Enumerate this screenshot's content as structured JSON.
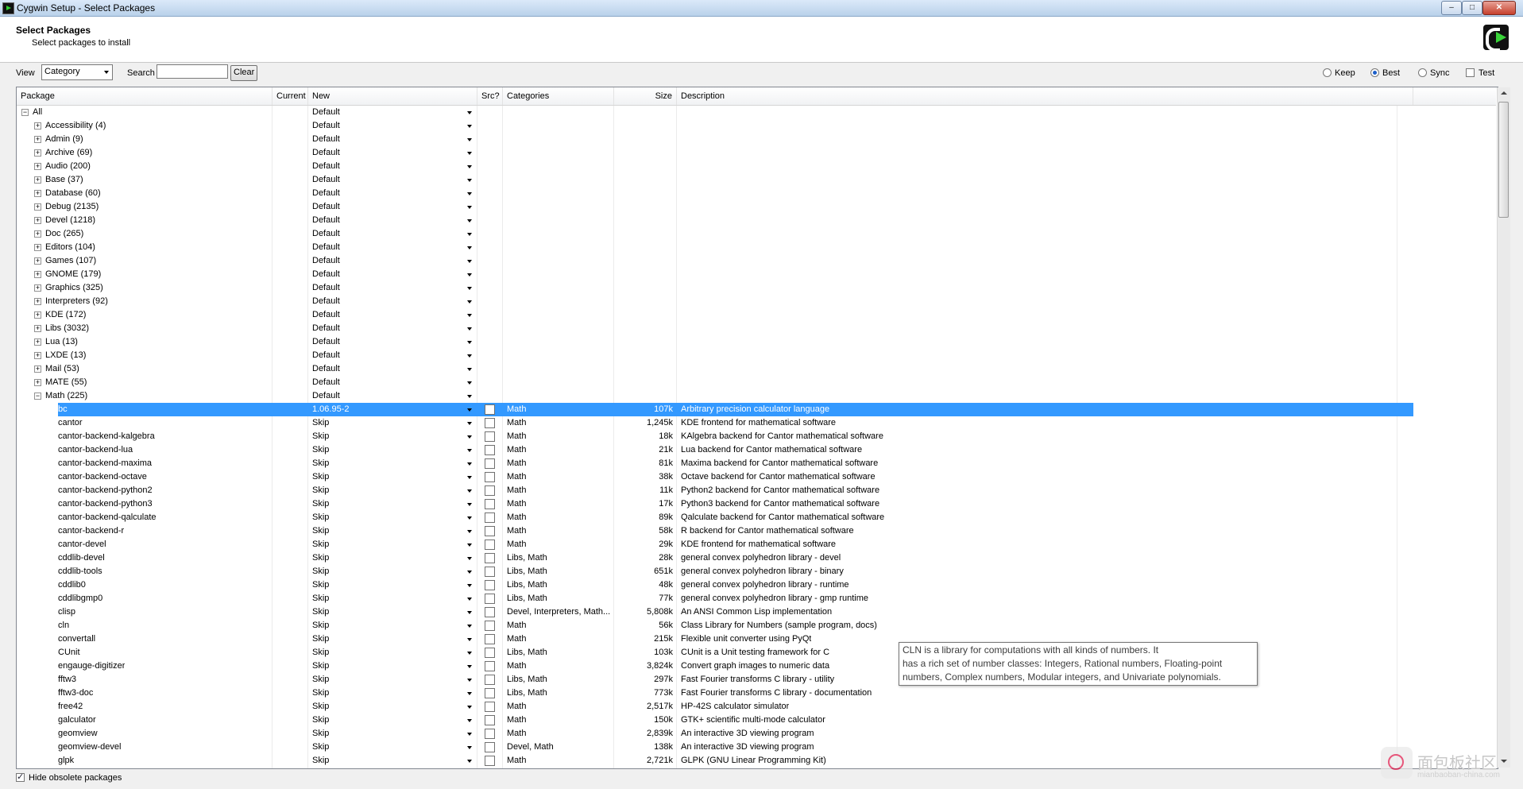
{
  "window": {
    "title": "Cygwin Setup - Select Packages",
    "minimize": "–",
    "maximize": "□",
    "close": "✕"
  },
  "header": {
    "title": "Select Packages",
    "subtitle": "Select packages to install"
  },
  "toolbar": {
    "view_label": "View",
    "view_value": "Category",
    "search_label": "Search",
    "search_value": "",
    "clear_label": "Clear",
    "keep_label": "Keep",
    "best_label": "Best",
    "sync_label": "Sync",
    "test_label": "Test",
    "selected_mode": "Best",
    "test_checked": false
  },
  "columns": [
    "Package",
    "Current",
    "New",
    "Src?",
    "Categories",
    "Size",
    "Description"
  ],
  "categories": [
    {
      "name": "All",
      "new": "Default",
      "expanded": true,
      "level": 0
    },
    {
      "name": "Accessibility (4)",
      "new": "Default",
      "level": 1
    },
    {
      "name": "Admin (9)",
      "new": "Default",
      "level": 1
    },
    {
      "name": "Archive (69)",
      "new": "Default",
      "level": 1
    },
    {
      "name": "Audio (200)",
      "new": "Default",
      "level": 1
    },
    {
      "name": "Base (37)",
      "new": "Default",
      "level": 1
    },
    {
      "name": "Database (60)",
      "new": "Default",
      "level": 1
    },
    {
      "name": "Debug (2135)",
      "new": "Default",
      "level": 1
    },
    {
      "name": "Devel (1218)",
      "new": "Default",
      "level": 1
    },
    {
      "name": "Doc (265)",
      "new": "Default",
      "level": 1
    },
    {
      "name": "Editors (104)",
      "new": "Default",
      "level": 1
    },
    {
      "name": "Games (107)",
      "new": "Default",
      "level": 1
    },
    {
      "name": "GNOME (179)",
      "new": "Default",
      "level": 1
    },
    {
      "name": "Graphics (325)",
      "new": "Default",
      "level": 1
    },
    {
      "name": "Interpreters (92)",
      "new": "Default",
      "level": 1
    },
    {
      "name": "KDE (172)",
      "new": "Default",
      "level": 1
    },
    {
      "name": "Libs (3032)",
      "new": "Default",
      "level": 1
    },
    {
      "name": "Lua (13)",
      "new": "Default",
      "level": 1
    },
    {
      "name": "LXDE (13)",
      "new": "Default",
      "level": 1
    },
    {
      "name": "Mail (53)",
      "new": "Default",
      "level": 1
    },
    {
      "name": "MATE (55)",
      "new": "Default",
      "level": 1
    },
    {
      "name": "Math (225)",
      "new": "Default",
      "expanded": true,
      "level": 1
    }
  ],
  "packages": [
    {
      "name": "bc",
      "current": "",
      "new": "1.06.95-2",
      "categories": "Math",
      "size": "107k",
      "description": "Arbitrary precision calculator language",
      "selected": true
    },
    {
      "name": "cantor",
      "current": "",
      "new": "Skip",
      "categories": "Math",
      "size": "1,245k",
      "description": "KDE frontend for mathematical software"
    },
    {
      "name": "cantor-backend-kalgebra",
      "current": "",
      "new": "Skip",
      "categories": "Math",
      "size": "18k",
      "description": "KAlgebra backend for Cantor mathematical software"
    },
    {
      "name": "cantor-backend-lua",
      "current": "",
      "new": "Skip",
      "categories": "Math",
      "size": "21k",
      "description": "Lua backend for Cantor mathematical software"
    },
    {
      "name": "cantor-backend-maxima",
      "current": "",
      "new": "Skip",
      "categories": "Math",
      "size": "81k",
      "description": "Maxima backend for Cantor mathematical software"
    },
    {
      "name": "cantor-backend-octave",
      "current": "",
      "new": "Skip",
      "categories": "Math",
      "size": "38k",
      "description": "Octave backend for Cantor mathematical software"
    },
    {
      "name": "cantor-backend-python2",
      "current": "",
      "new": "Skip",
      "categories": "Math",
      "size": "11k",
      "description": "Python2 backend for Cantor mathematical software"
    },
    {
      "name": "cantor-backend-python3",
      "current": "",
      "new": "Skip",
      "categories": "Math",
      "size": "17k",
      "description": "Python3 backend for Cantor mathematical software"
    },
    {
      "name": "cantor-backend-qalculate",
      "current": "",
      "new": "Skip",
      "categories": "Math",
      "size": "89k",
      "description": "Qalculate backend for Cantor mathematical software"
    },
    {
      "name": "cantor-backend-r",
      "current": "",
      "new": "Skip",
      "categories": "Math",
      "size": "58k",
      "description": "R backend for Cantor mathematical software"
    },
    {
      "name": "cantor-devel",
      "current": "",
      "new": "Skip",
      "categories": "Math",
      "size": "29k",
      "description": "KDE frontend for mathematical software"
    },
    {
      "name": "cddlib-devel",
      "current": "",
      "new": "Skip",
      "categories": "Libs, Math",
      "size": "28k",
      "description": "general convex polyhedron library - devel"
    },
    {
      "name": "cddlib-tools",
      "current": "",
      "new": "Skip",
      "categories": "Libs, Math",
      "size": "651k",
      "description": "general convex polyhedron library - binary"
    },
    {
      "name": "cddlib0",
      "current": "",
      "new": "Skip",
      "categories": "Libs, Math",
      "size": "48k",
      "description": "general convex polyhedron library - runtime"
    },
    {
      "name": "cddlibgmp0",
      "current": "",
      "new": "Skip",
      "categories": "Libs, Math",
      "size": "77k",
      "description": "general convex polyhedron library - gmp runtime"
    },
    {
      "name": "clisp",
      "current": "",
      "new": "Skip",
      "categories": "Devel, Interpreters, Math...",
      "size": "5,808k",
      "description": "An ANSI Common Lisp implementation"
    },
    {
      "name": "cln",
      "current": "",
      "new": "Skip",
      "categories": "Math",
      "size": "56k",
      "description": "Class Library for Numbers (sample program, docs)"
    },
    {
      "name": "convertall",
      "current": "",
      "new": "Skip",
      "categories": "Math",
      "size": "215k",
      "description": "Flexible unit converter using PyQt"
    },
    {
      "name": "CUnit",
      "current": "",
      "new": "Skip",
      "categories": "Libs, Math",
      "size": "103k",
      "description": "CUnit is a Unit testing framework for C"
    },
    {
      "name": "engauge-digitizer",
      "current": "",
      "new": "Skip",
      "categories": "Math",
      "size": "3,824k",
      "description": "Convert graph images to numeric data"
    },
    {
      "name": "fftw3",
      "current": "",
      "new": "Skip",
      "categories": "Libs, Math",
      "size": "297k",
      "description": "Fast Fourier transforms C library - utility"
    },
    {
      "name": "fftw3-doc",
      "current": "",
      "new": "Skip",
      "categories": "Libs, Math",
      "size": "773k",
      "description": "Fast Fourier transforms C library - documentation"
    },
    {
      "name": "free42",
      "current": "",
      "new": "Skip",
      "categories": "Math",
      "size": "2,517k",
      "description": "HP-42S calculator simulator"
    },
    {
      "name": "galculator",
      "current": "",
      "new": "Skip",
      "categories": "Math",
      "size": "150k",
      "description": "GTK+ scientific multi-mode calculator"
    },
    {
      "name": "geomview",
      "current": "",
      "new": "Skip",
      "categories": "Math",
      "size": "2,839k",
      "description": "An interactive 3D viewing program"
    },
    {
      "name": "geomview-devel",
      "current": "",
      "new": "Skip",
      "categories": "Devel, Math",
      "size": "138k",
      "description": "An interactive 3D viewing program"
    },
    {
      "name": "glpk",
      "current": "",
      "new": "Skip",
      "categories": "Math",
      "size": "2,721k",
      "description": "GLPK (GNU Linear Programming Kit)"
    }
  ],
  "tooltip": {
    "lines": [
      "CLN is a library for computations with all kinds of numbers. It",
      "has a rich set of number classes: Integers, Rational numbers, Floating-point",
      "numbers, Complex numbers, Modular integers, and Univariate polynomials."
    ]
  },
  "footer": {
    "hide_obsolete_label": "Hide obsolete packages",
    "hide_obsolete_checked": true
  },
  "watermark": {
    "text": "面包板社区",
    "sub": "mianbaoban-china.com"
  },
  "colors": {
    "selection": "#3399ff",
    "accent": "#39d339"
  }
}
